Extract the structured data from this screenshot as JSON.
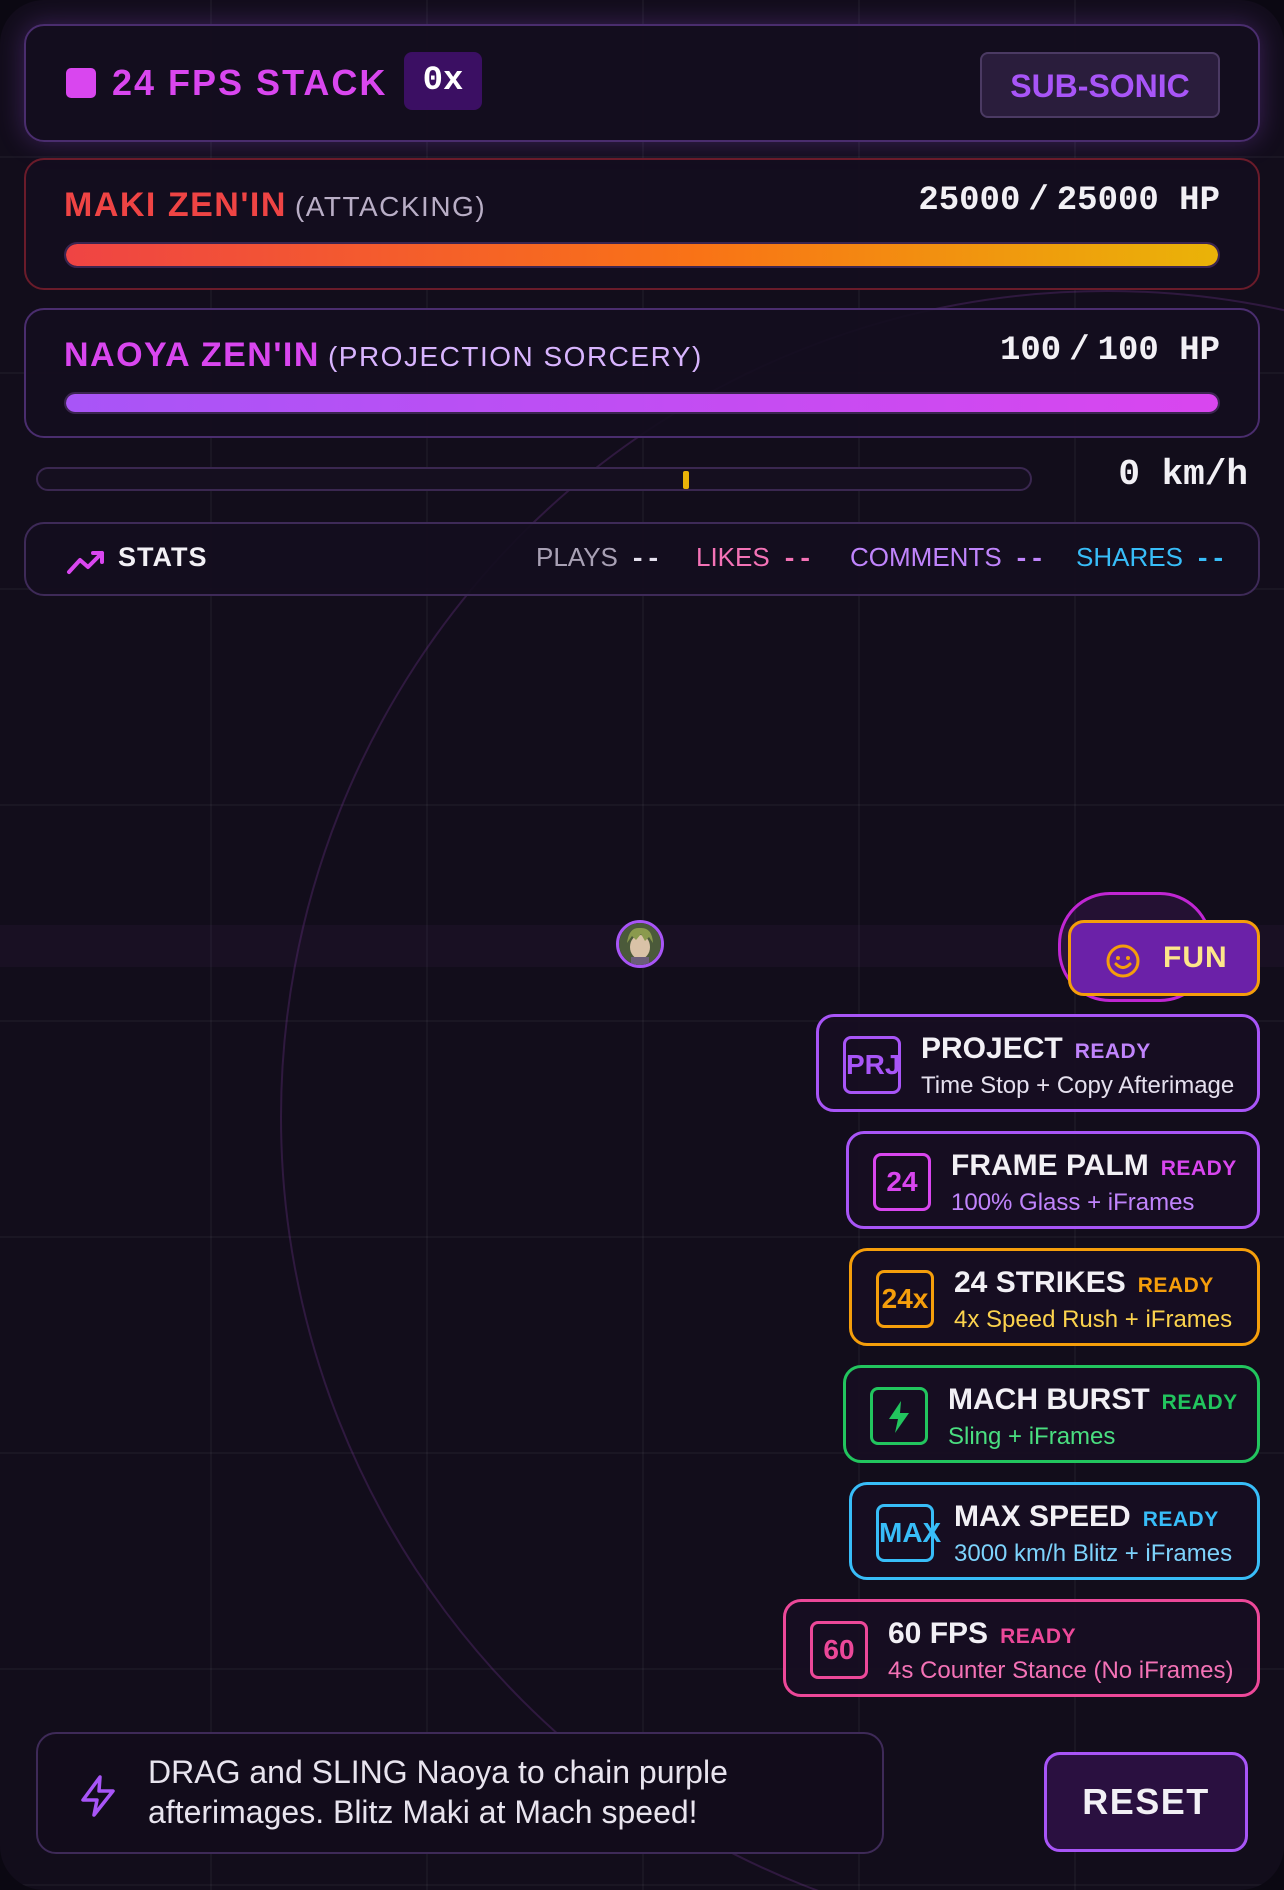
{
  "fps_stack": {
    "label": "24 FPS STACK",
    "combo": "0x",
    "speed_tier": "SUB-SONIC"
  },
  "maki": {
    "name": "MAKI ZEN'IN",
    "status": "(ATTACKING)",
    "hp_current": "25000",
    "hp_sep": "/",
    "hp_max": "25000 HP",
    "hp_fraction": 1.0,
    "color": "#ef4444"
  },
  "naoya": {
    "name": "NAOYA ZEN'IN",
    "status": "(PROJECTION SORCERY)",
    "hp_current": "100",
    "hp_sep": "/",
    "hp_max": "100 HP",
    "hp_fraction": 1.0,
    "color": "#d946ef"
  },
  "speed": {
    "value": "0 km/h",
    "needle_fraction": 0.65,
    "needle_color": "#eab308"
  },
  "stats": {
    "title": "STATS",
    "icon": "trending-up-icon",
    "items": [
      {
        "label": "PLAYS",
        "value": "--",
        "color": "#a8a0b4"
      },
      {
        "label": "LIKES",
        "value": "--",
        "color": "#f472b6"
      },
      {
        "label": "COMMENTS",
        "value": "--",
        "color": "#c084fc"
      },
      {
        "label": "SHARES",
        "value": "--",
        "color": "#38bdf8"
      }
    ]
  },
  "fun_button": {
    "label": "FUN",
    "icon": "smiley-icon",
    "color": "#f59e0b"
  },
  "abilities": [
    {
      "code": "PRJ",
      "title": "PROJECT",
      "status": "READY",
      "desc": "Time Stop + Copy Afterimage",
      "color": "#a855f7",
      "desc_color": "#e5e0ee"
    },
    {
      "code": "24",
      "title": "FRAME PALM",
      "status": "READY",
      "desc": "100% Glass + iFrames",
      "color": "#d946ef",
      "desc_color": "#c084fc"
    },
    {
      "code": "24x",
      "title": "24 STRIKES",
      "status": "READY",
      "desc": "4x Speed Rush + iFrames",
      "color": "#f59e0b",
      "desc_color": "#fcd34d"
    },
    {
      "code": "",
      "icon": "lightning-icon",
      "title": "MACH BURST",
      "status": "READY",
      "desc": "Sling + iFrames",
      "color": "#22c55e",
      "desc_color": "#4ade80"
    },
    {
      "code": "MAX",
      "title": "MAX SPEED",
      "status": "READY",
      "desc": "3000 km/h Blitz + iFrames",
      "color": "#38bdf8",
      "desc_color": "#7dd3fc"
    },
    {
      "code": "60",
      "title": "60 FPS",
      "status": "READY",
      "desc": "4s Counter Stance (No iFrames)",
      "color": "#ec4899",
      "desc_color": "#f472b6"
    }
  ],
  "tip": {
    "text": "DRAG and SLING Naoya to chain purple afterimages. Blitz Maki at Mach speed!",
    "icon": "lightning-outline-icon"
  },
  "reset": {
    "label": "RESET"
  }
}
